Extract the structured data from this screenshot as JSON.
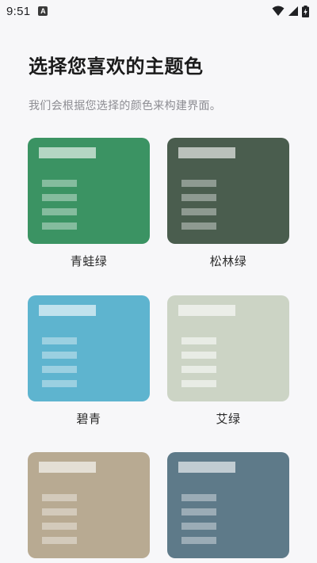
{
  "status_bar": {
    "time": "9:51",
    "notification_icon": "A",
    "icons": [
      "wifi-icon",
      "cell-signal-icon",
      "battery-charging-icon"
    ]
  },
  "page": {
    "title": "选择您喜欢的主题色",
    "subtitle": "我们会根据您选择的颜色来构建界面。"
  },
  "themes": [
    {
      "name": "青蛙绿",
      "color": "#3B9363"
    },
    {
      "name": "松林绿",
      "color": "#4A5D4E"
    },
    {
      "name": "碧青",
      "color": "#5EB4CF"
    },
    {
      "name": "艾绿",
      "color": "#CCD4C5"
    },
    {
      "name": "",
      "color": "#B8AA92"
    },
    {
      "name": "",
      "color": "#5E7A89"
    }
  ]
}
